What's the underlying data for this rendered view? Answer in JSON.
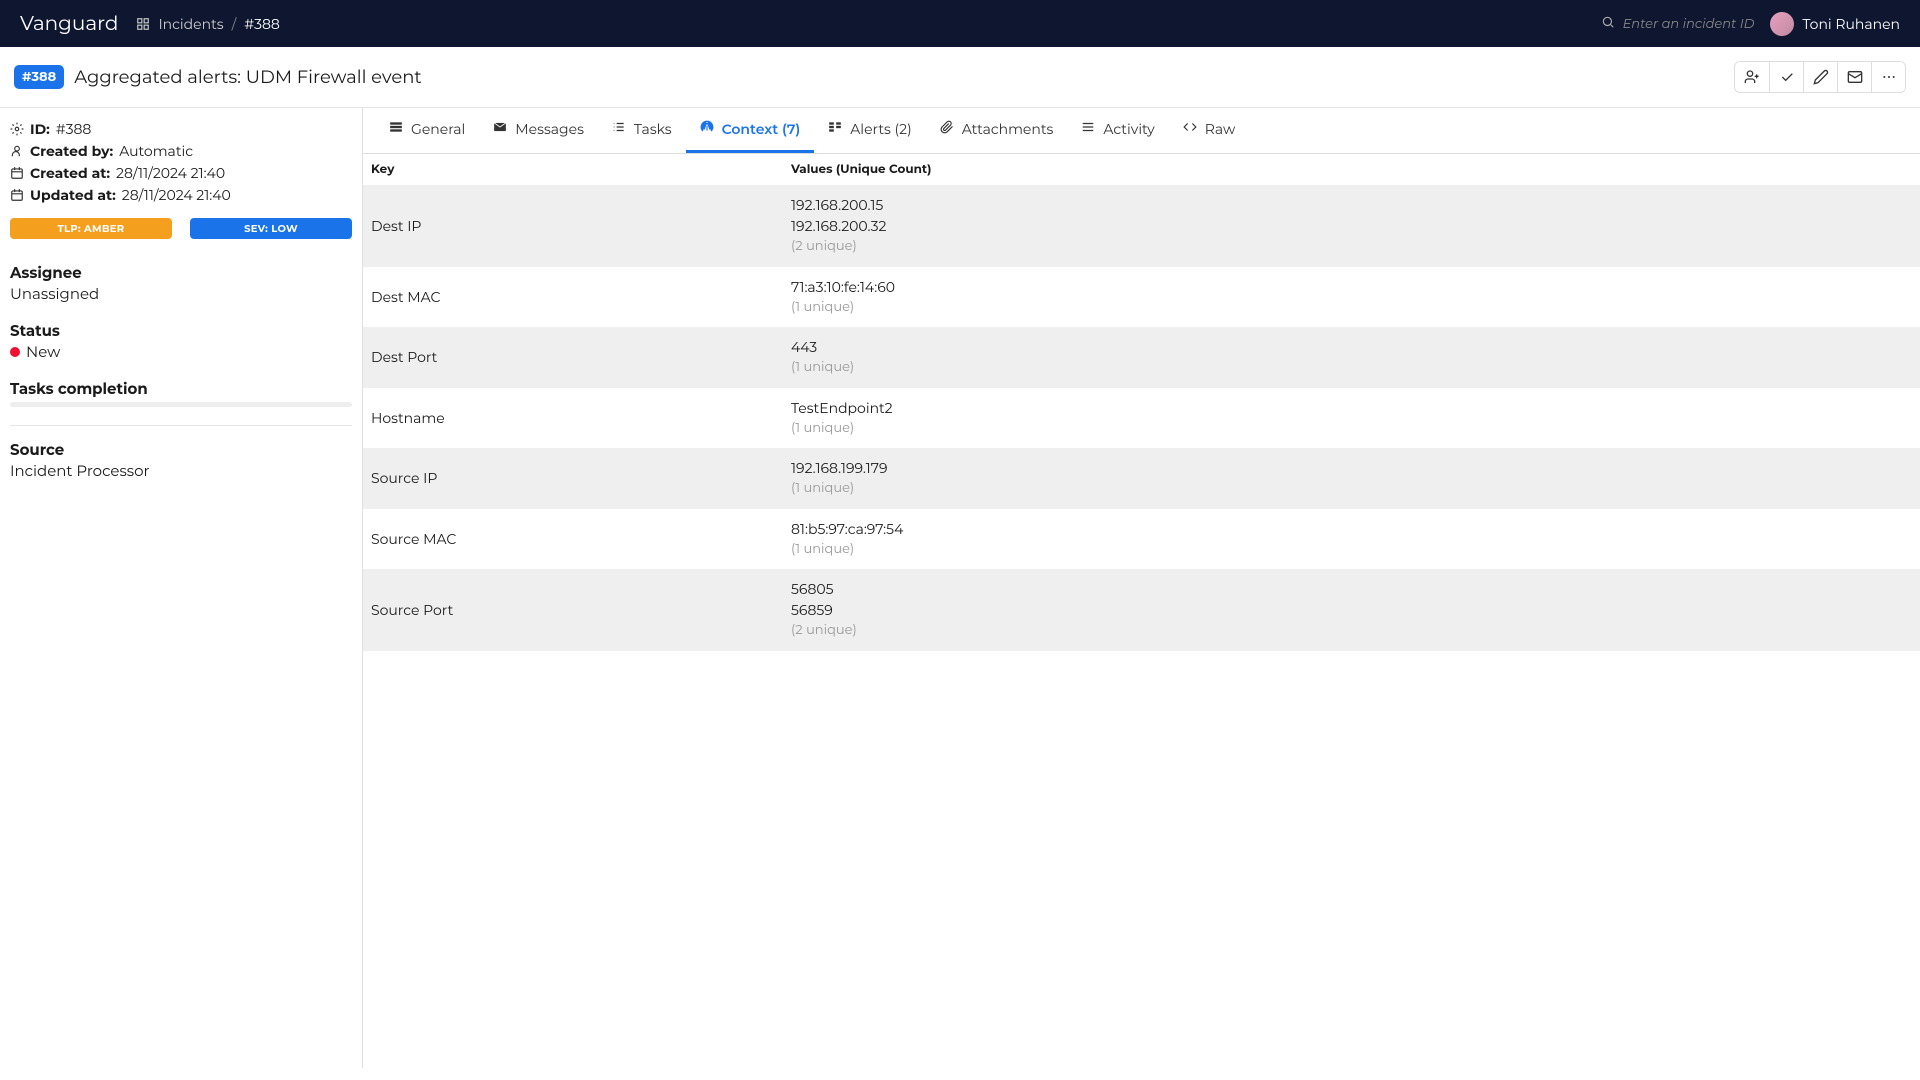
{
  "topbar": {
    "brand": "Vanguard",
    "breadcrumb_section": "Incidents",
    "breadcrumb_current": "#388",
    "search_placeholder": "Enter an incident ID",
    "user_name": "Toni Ruhanen"
  },
  "header": {
    "id_badge": "#388",
    "title": "Aggregated alerts: UDM Firewall event"
  },
  "sidebar": {
    "id_label": "ID:",
    "id_value": "#388",
    "created_by_label": "Created by:",
    "created_by_value": "Automatic",
    "created_at_label": "Created at:",
    "created_at_value": "28/11/2024 21:40",
    "updated_at_label": "Updated at:",
    "updated_at_value": "28/11/2024 21:40",
    "pill_tlp": "TLP: AMBER",
    "pill_sev": "SEV: LOW",
    "assignee_label": "Assignee",
    "assignee_value": "Unassigned",
    "status_label": "Status",
    "status_value": "New",
    "tasks_label": "Tasks completion",
    "source_label": "Source",
    "source_value": "Incident Processor"
  },
  "tabs": {
    "general": "General",
    "messages": "Messages",
    "tasks": "Tasks",
    "context": "Context (7)",
    "alerts": "Alerts (2)",
    "attachments": "Attachments",
    "activity": "Activity",
    "raw": "Raw"
  },
  "context_table": {
    "col_key": "Key",
    "col_values": "Values (Unique Count)",
    "rows": [
      {
        "key": "Dest IP",
        "values": [
          "192.168.200.15",
          "192.168.200.32"
        ],
        "unique": "(2 unique)"
      },
      {
        "key": "Dest MAC",
        "values": [
          "71:a3:10:fe:14:60"
        ],
        "unique": "(1 unique)"
      },
      {
        "key": "Dest Port",
        "values": [
          "443"
        ],
        "unique": "(1 unique)"
      },
      {
        "key": "Hostname",
        "values": [
          "TestEndpoint2"
        ],
        "unique": "(1 unique)"
      },
      {
        "key": "Source IP",
        "values": [
          "192.168.199.179"
        ],
        "unique": "(1 unique)"
      },
      {
        "key": "Source MAC",
        "values": [
          "81:b5:97:ca:97:54"
        ],
        "unique": "(1 unique)"
      },
      {
        "key": "Source Port",
        "values": [
          "56805",
          "56859"
        ],
        "unique": "(2 unique)"
      }
    ]
  }
}
